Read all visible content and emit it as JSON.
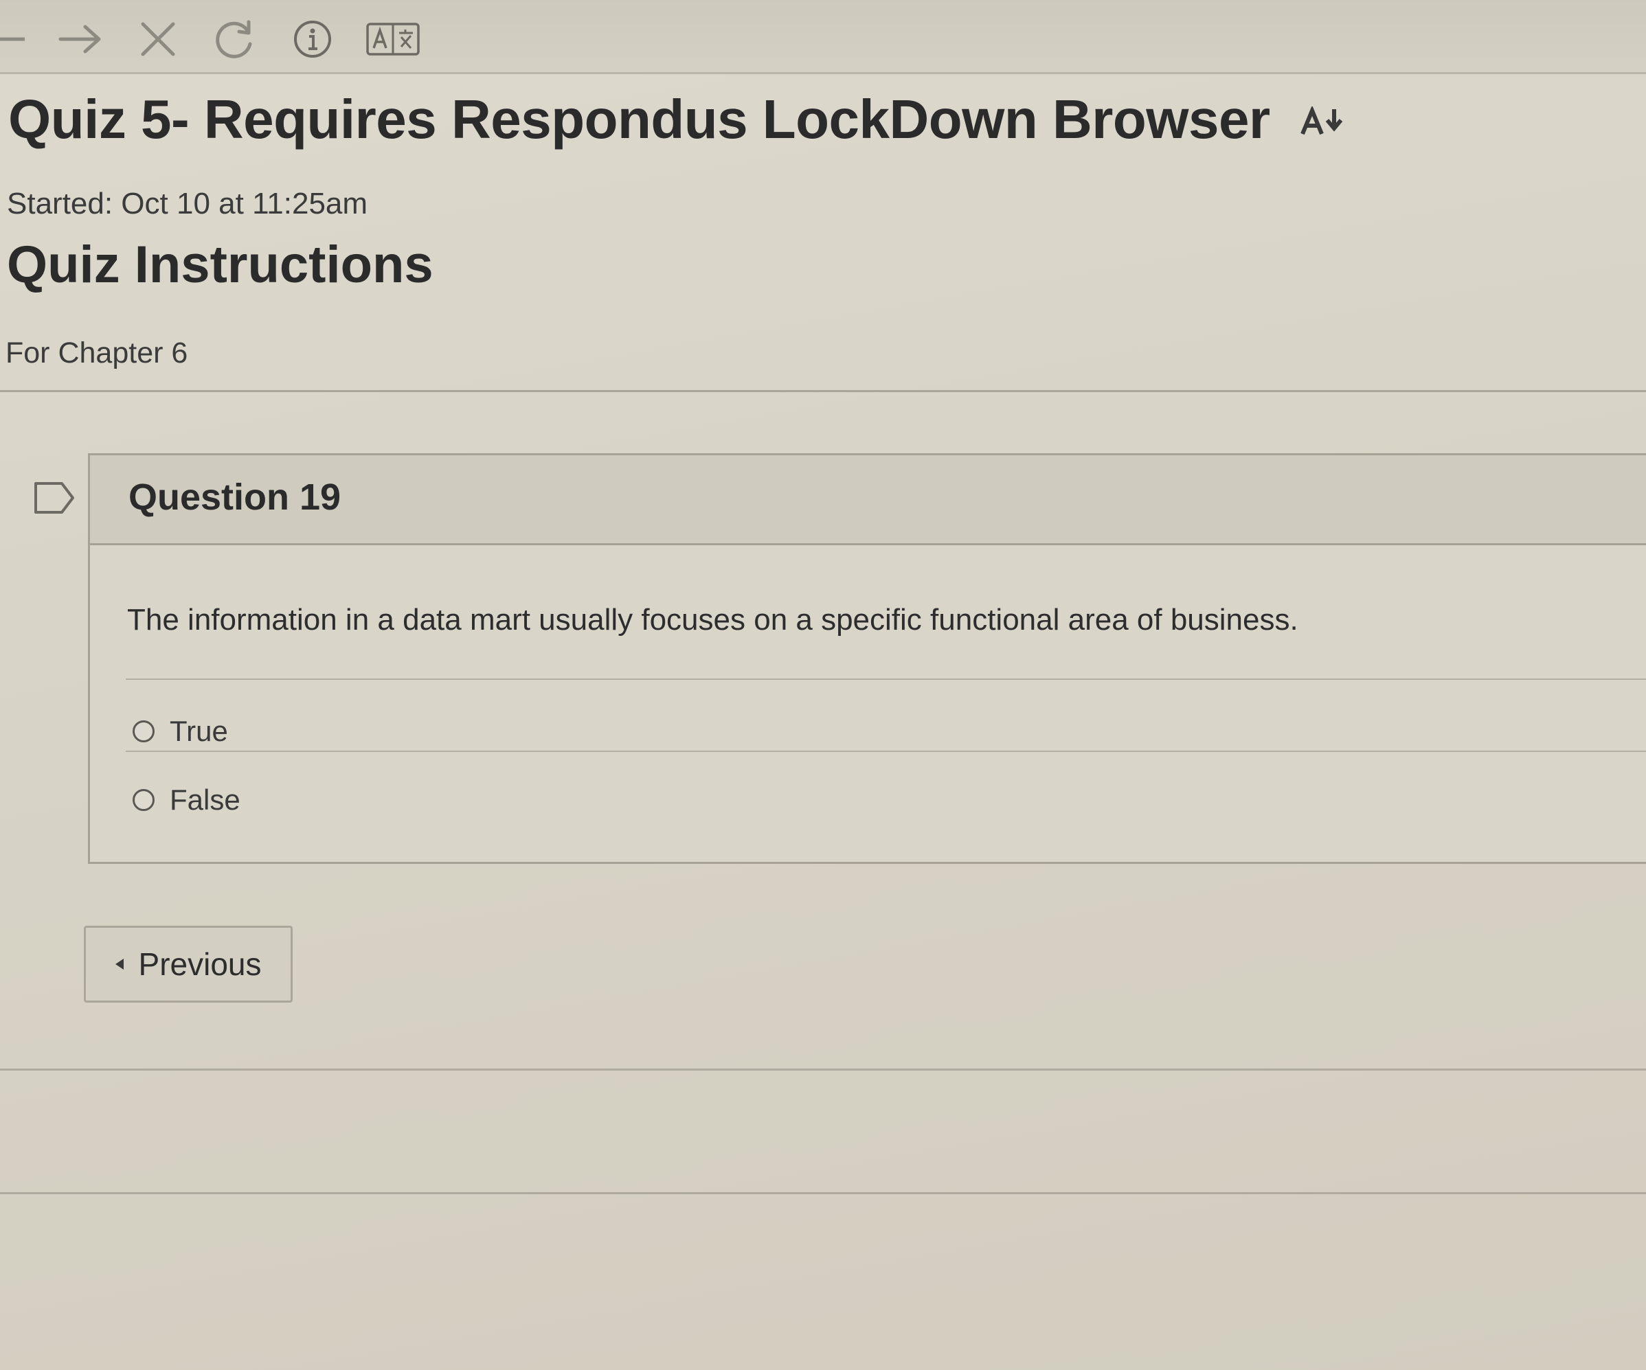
{
  "browser": {
    "icons": [
      "back-arrow-icon",
      "forward-arrow-icon",
      "stop-icon",
      "reload-icon",
      "info-icon",
      "translate-icon"
    ]
  },
  "quiz": {
    "title": "Quiz 5- Requires Respondus LockDown Browser",
    "started": "Started: Oct 10 at 11:25am",
    "instructions_heading": "Quiz Instructions",
    "instructions_text": "For Chapter 6"
  },
  "question": {
    "title": "Question 19",
    "text": "The information in a data mart usually focuses on a specific functional area of business.",
    "answers": [
      {
        "label": "True",
        "selected": false
      },
      {
        "label": "False",
        "selected": false
      }
    ]
  },
  "navigation": {
    "previous_label": "Previous"
  },
  "colors": {
    "background": "#d8d4c8",
    "text": "#2b2b2b",
    "border": "#a6a296"
  }
}
